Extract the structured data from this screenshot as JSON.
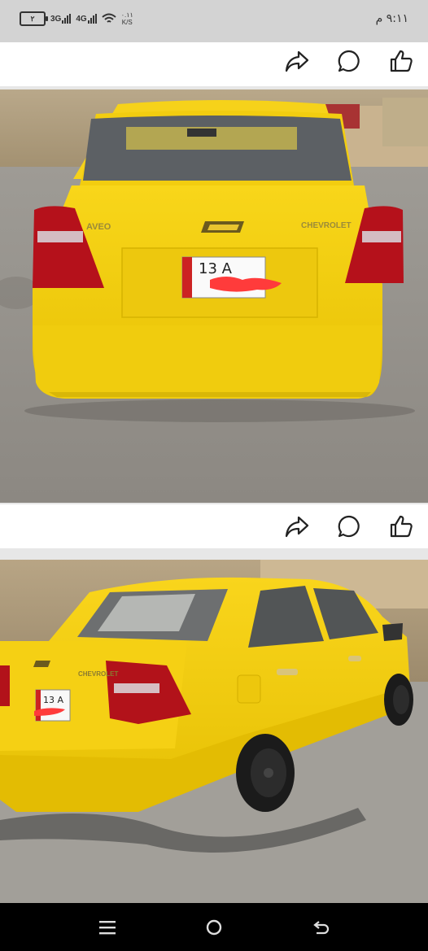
{
  "status": {
    "battery_label": "٢",
    "network_1": "3G",
    "network_2": "4G",
    "speed_value": "٠.١١",
    "speed_unit": "K/S",
    "time": "٩:١١ م"
  },
  "post_actions": [
    "share-icon",
    "comment-icon",
    "like-icon"
  ],
  "photos": [
    {
      "subject": "yellow Chevrolet Aveo sedan rear view",
      "badge_left": "AVEO",
      "badge_right": "CHEVROLET",
      "plate": "13 A"
    },
    {
      "subject": "yellow Chevrolet Aveo sedan rear three-quarter view",
      "badge_right": "CHEVROLET",
      "plate": "13 A"
    }
  ],
  "colors": {
    "car_yellow": "#f4cf10",
    "status_bar": "#d3d3d3",
    "nav_bar": "#000000"
  },
  "nav": [
    "recent-apps-icon",
    "home-icon",
    "back-icon"
  ]
}
